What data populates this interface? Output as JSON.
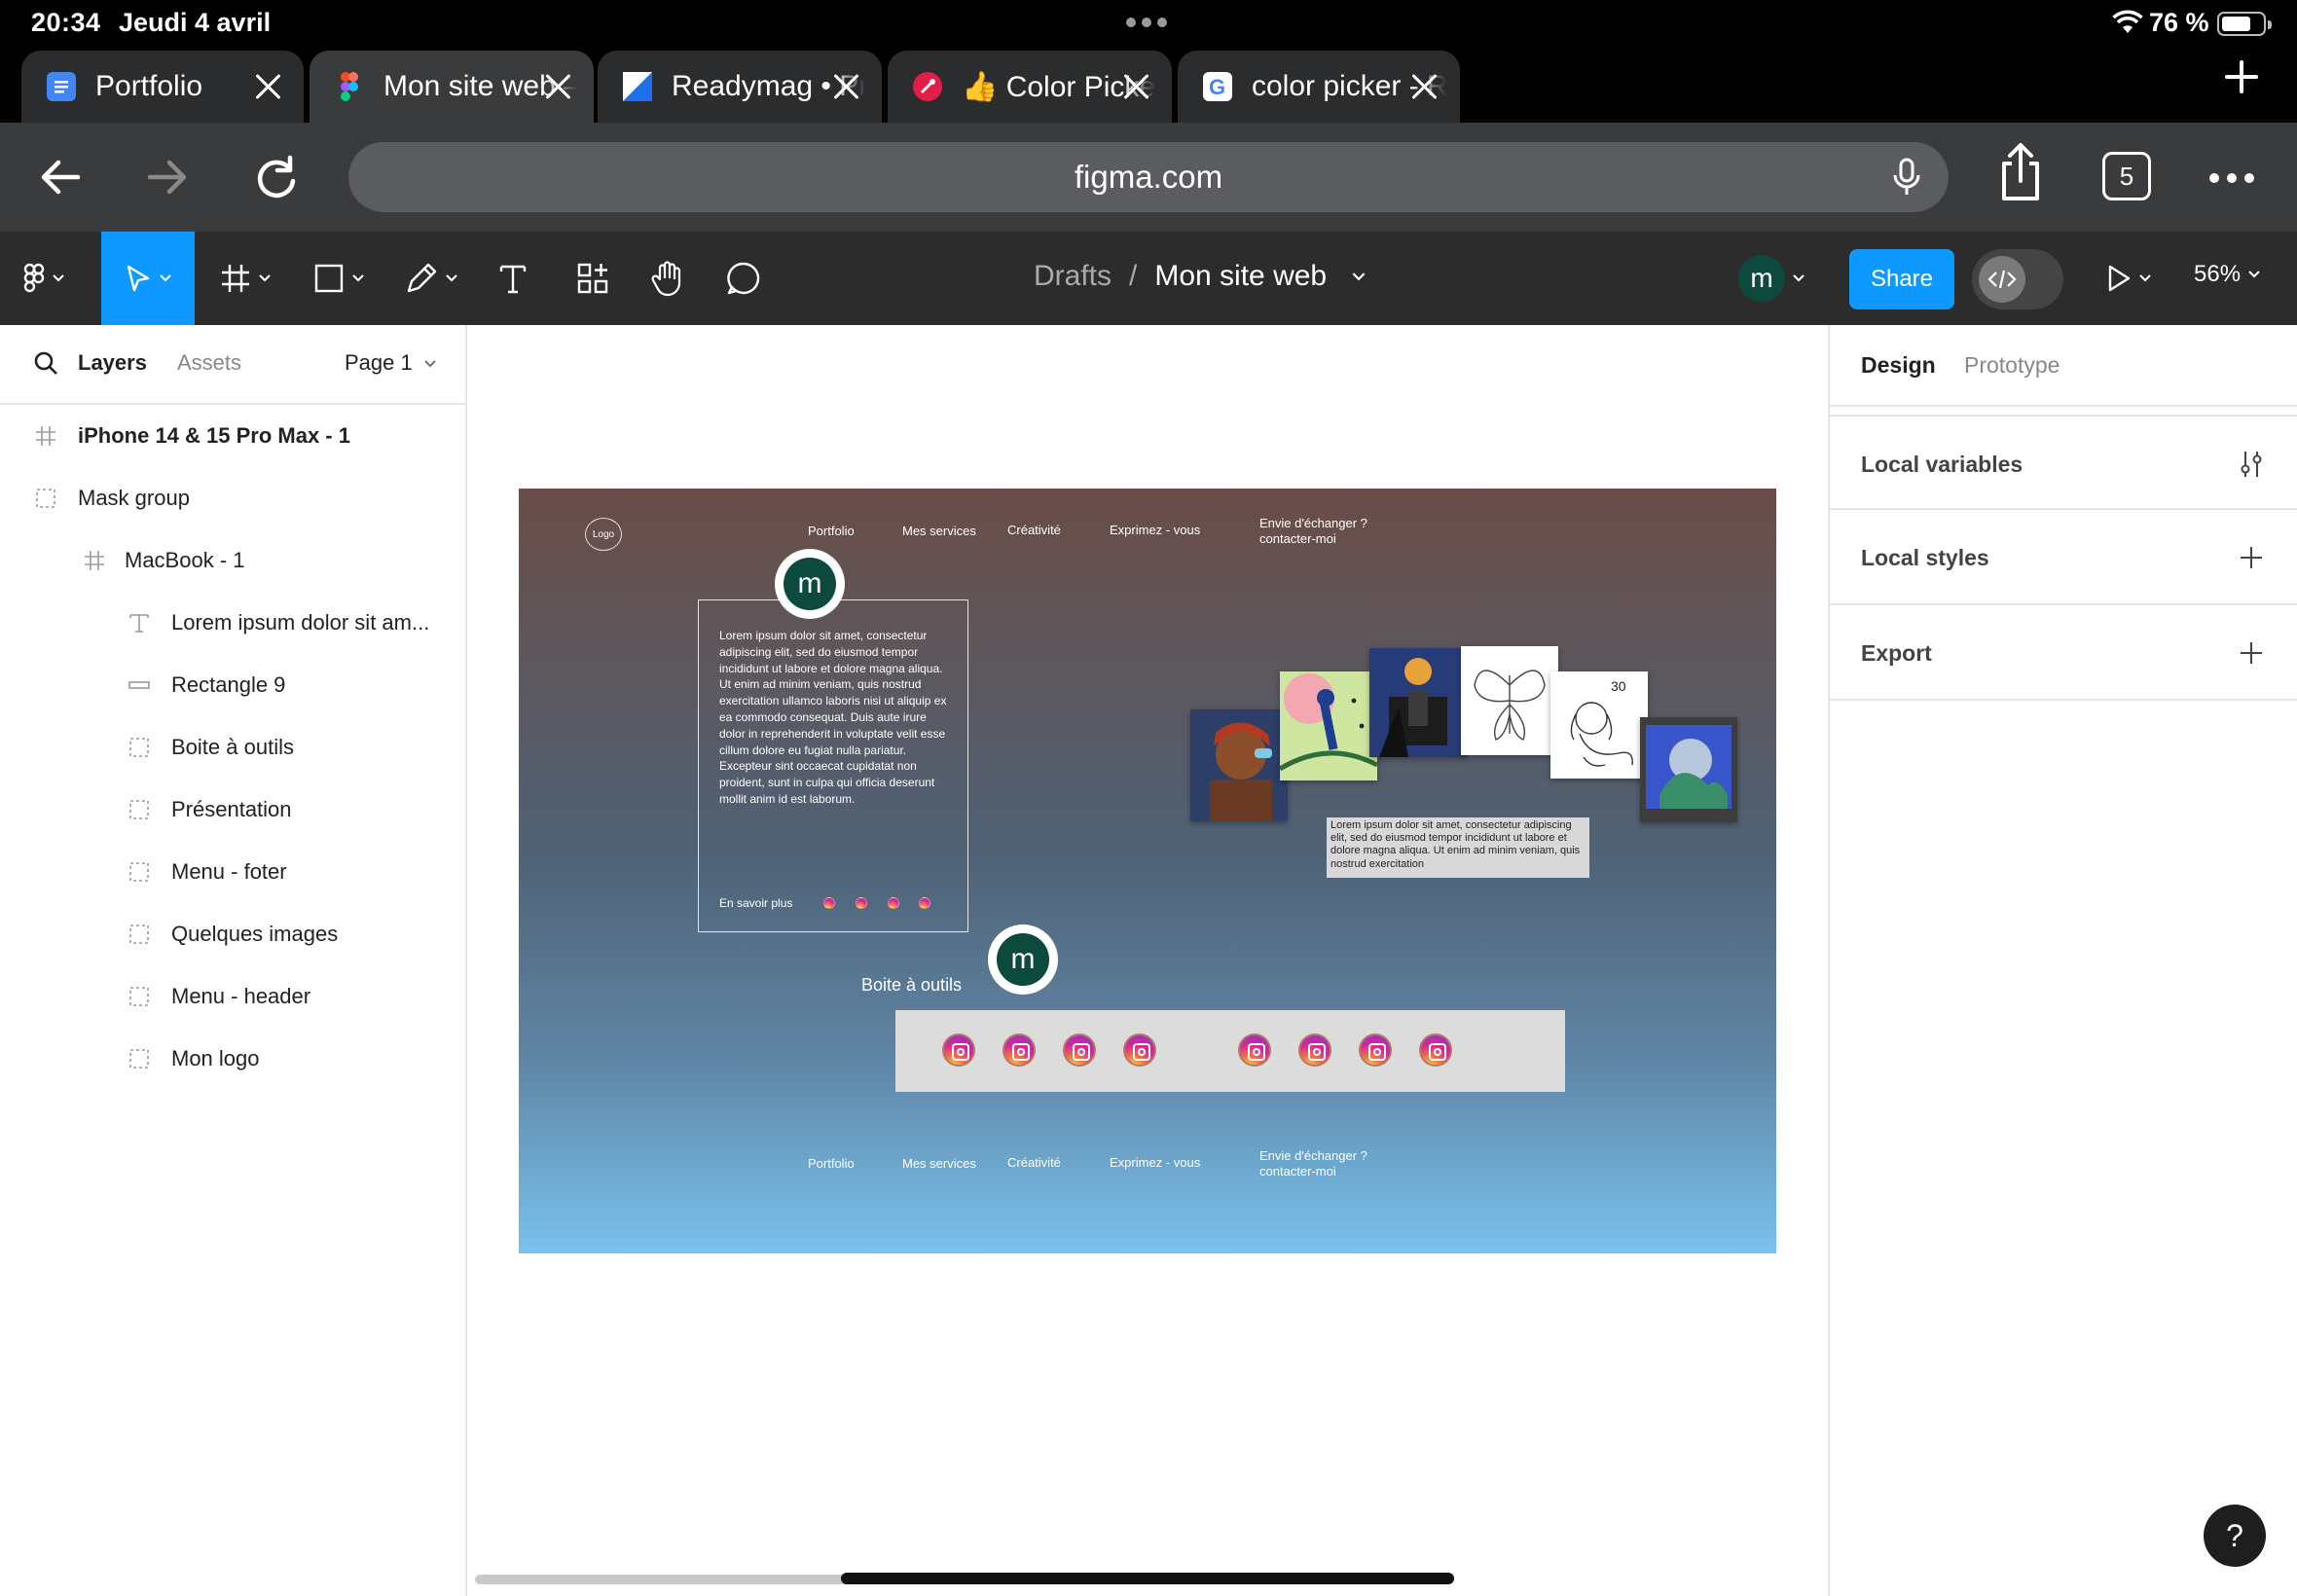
{
  "status_bar": {
    "time": "20:34",
    "date": "Jeudi 4 avril",
    "battery": "76 %"
  },
  "browser": {
    "tabs": [
      {
        "label": "Portfolio",
        "favicon": "docs-icon",
        "color": "#4285f4"
      },
      {
        "label": "Mon site web – Figma",
        "favicon": "figma-icon",
        "color": "#f24e1e",
        "active": true
      },
      {
        "label": "Readymag • Projet • Mon",
        "favicon": "readymag-icon",
        "color": "#1f6feb"
      },
      {
        "label": "👍 Color Picker online | ",
        "favicon": "color-picker-icon",
        "color": "#e11d48"
      },
      {
        "label": "color picker - Recherche",
        "favicon": "google-icon",
        "color": "#4285f4"
      }
    ],
    "url": "figma.com",
    "tab_count": "5"
  },
  "figma": {
    "breadcrumb": {
      "folder": "Drafts",
      "separator": "/",
      "file": "Mon site web"
    },
    "user_initial": "m",
    "share_label": "Share",
    "zoom": "56%",
    "accent": "#0d99ff"
  },
  "left_panel": {
    "tabs": {
      "layers": "Layers",
      "assets": "Assets"
    },
    "page": "Page 1",
    "layers": [
      {
        "name": "iPhone 14 & 15 Pro Max - 1",
        "icon": "frame-icon",
        "indent": 0,
        "bold": true
      },
      {
        "name": "Mask group",
        "icon": "group-icon",
        "indent": 0
      },
      {
        "name": "MacBook - 1",
        "icon": "frame-icon",
        "indent": 1
      },
      {
        "name": "Lorem ipsum dolor sit am...",
        "icon": "text-icon",
        "indent": 2
      },
      {
        "name": "Rectangle 9",
        "icon": "rectangle-icon",
        "indent": 2
      },
      {
        "name": "Boite à outils",
        "icon": "group-icon",
        "indent": 2
      },
      {
        "name": "Présentation",
        "icon": "group-icon",
        "indent": 2
      },
      {
        "name": "Menu - foter",
        "icon": "group-icon",
        "indent": 2
      },
      {
        "name": "Quelques images",
        "icon": "group-icon",
        "indent": 2
      },
      {
        "name": "Menu - header",
        "icon": "group-icon",
        "indent": 2
      },
      {
        "name": "Mon logo",
        "icon": "group-icon",
        "indent": 2
      }
    ]
  },
  "right_panel": {
    "tabs": {
      "design": "Design",
      "prototype": "Prototype"
    },
    "sections": {
      "variables": "Local variables",
      "styles": "Local styles",
      "export": "Export"
    }
  },
  "design": {
    "logo": "Logo",
    "nav": [
      {
        "label": "Portfolio"
      },
      {
        "label": "Mes services"
      },
      {
        "label": "Créativité"
      },
      {
        "label": "Exprimez - vous"
      },
      {
        "label": "Envie d'échanger ?\ncontacter-moi"
      }
    ],
    "intro_text": "Lorem ipsum dolor sit amet, consectetur adipiscing elit, sed do eiusmod tempor incididunt ut labore et dolore magna aliqua. Ut enim ad minim veniam, quis nostrud exercitation ullamco laboris nisi ut aliquip ex ea commodo consequat. Duis aute irure dolor in reprehenderit in voluptate velit esse cillum dolore eu fugiat nulla pariatur. Excepteur sint occaecat cupidatat non proident, sunt in culpa qui officia deserunt mollit anim id est laborum.",
    "read_more": "En savoir plus",
    "avatar_initial": "m",
    "tools_title": "Boite à outils",
    "image_caption": "Lorem ipsum dolor sit amet, consectetur adipiscing elit, sed do eiusmod tempor incididunt ut labore et dolore magna aliqua. Ut enim ad minim veniam, quis nostrud exercitation",
    "sketch_number": "30",
    "footer_nav": [
      {
        "label": "Portfolio"
      },
      {
        "label": "Mes services"
      },
      {
        "label": "Créativité"
      },
      {
        "label": "Exprimez - vous"
      },
      {
        "label": "Envie d'échanger ?\ncontacter-moi"
      }
    ]
  },
  "help_label": "?"
}
